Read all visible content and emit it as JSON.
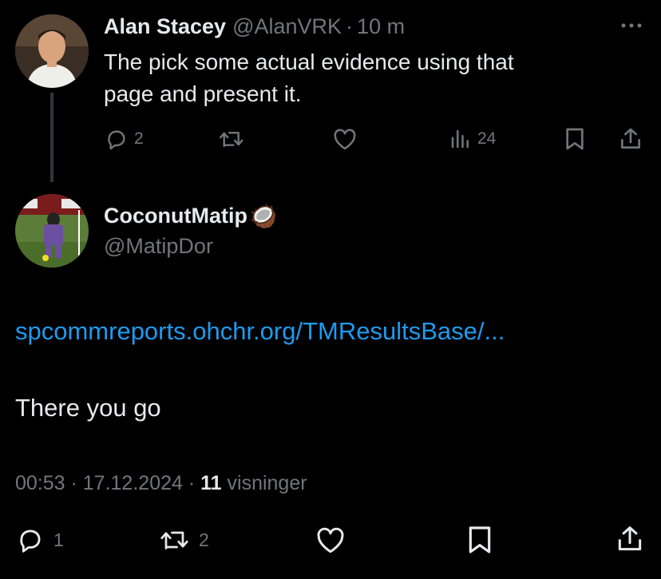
{
  "reply_tweet": {
    "author_name": "Alan Stacey",
    "handle": "@AlanVRK",
    "separator": "·",
    "time": "10 m",
    "text_line1": "The pick some actual evidence using that",
    "text_line2": "page and present it.",
    "actions": {
      "replies": "2",
      "retweets": "",
      "likes": "",
      "views": "24"
    }
  },
  "main_tweet": {
    "author_name": "CoconutMatip",
    "name_emoji": "🥥",
    "handle": "@MatipDor",
    "link_text": "spcommreports.ohchr.org/TMResultsBase/...",
    "body_text": "There you go",
    "timestamp": "00:53 · 17.12.2024 · ",
    "views_count": "11",
    "views_label": " visninger",
    "actions": {
      "replies": "1",
      "retweets": "2"
    }
  },
  "colors": {
    "background": "#000000",
    "text": "#e7e9ea",
    "muted": "#71767b",
    "link": "#1d9bf0"
  }
}
